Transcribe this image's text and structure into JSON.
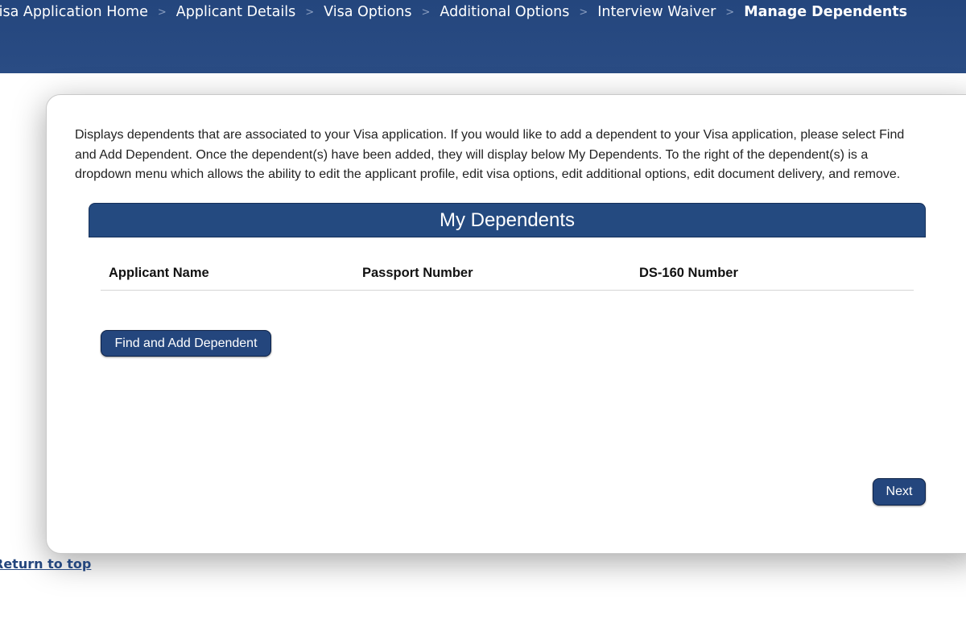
{
  "breadcrumb": {
    "items": [
      {
        "label": "Visa Application Home"
      },
      {
        "label": "Applicant Details"
      },
      {
        "label": "Visa Options"
      },
      {
        "label": "Additional Options"
      },
      {
        "label": "Interview Waiver"
      },
      {
        "label": "Manage Dependents"
      }
    ],
    "separator": ">"
  },
  "main": {
    "description": "Displays dependents that are associated to your Visa application. If you would like to add a dependent to your Visa application, please select Find and Add Dependent. Once the dependent(s) have been added, they will display below My Dependents. To the right of the dependent(s) is a dropdown menu which allows the ability to edit the applicant profile, edit visa options, edit additional options, edit document delivery, and remove.",
    "panel_title": "My Dependents",
    "table": {
      "columns": [
        "Applicant Name",
        "Passport Number",
        "DS-160 Number"
      ],
      "rows": []
    },
    "find_button_label": "Find and Add Dependent",
    "next_button_label": "Next"
  },
  "footer": {
    "return_link": "Return to top"
  },
  "colors": {
    "header_bg": "#24467d",
    "button_bg": "#24467d",
    "link": "#24467d"
  }
}
